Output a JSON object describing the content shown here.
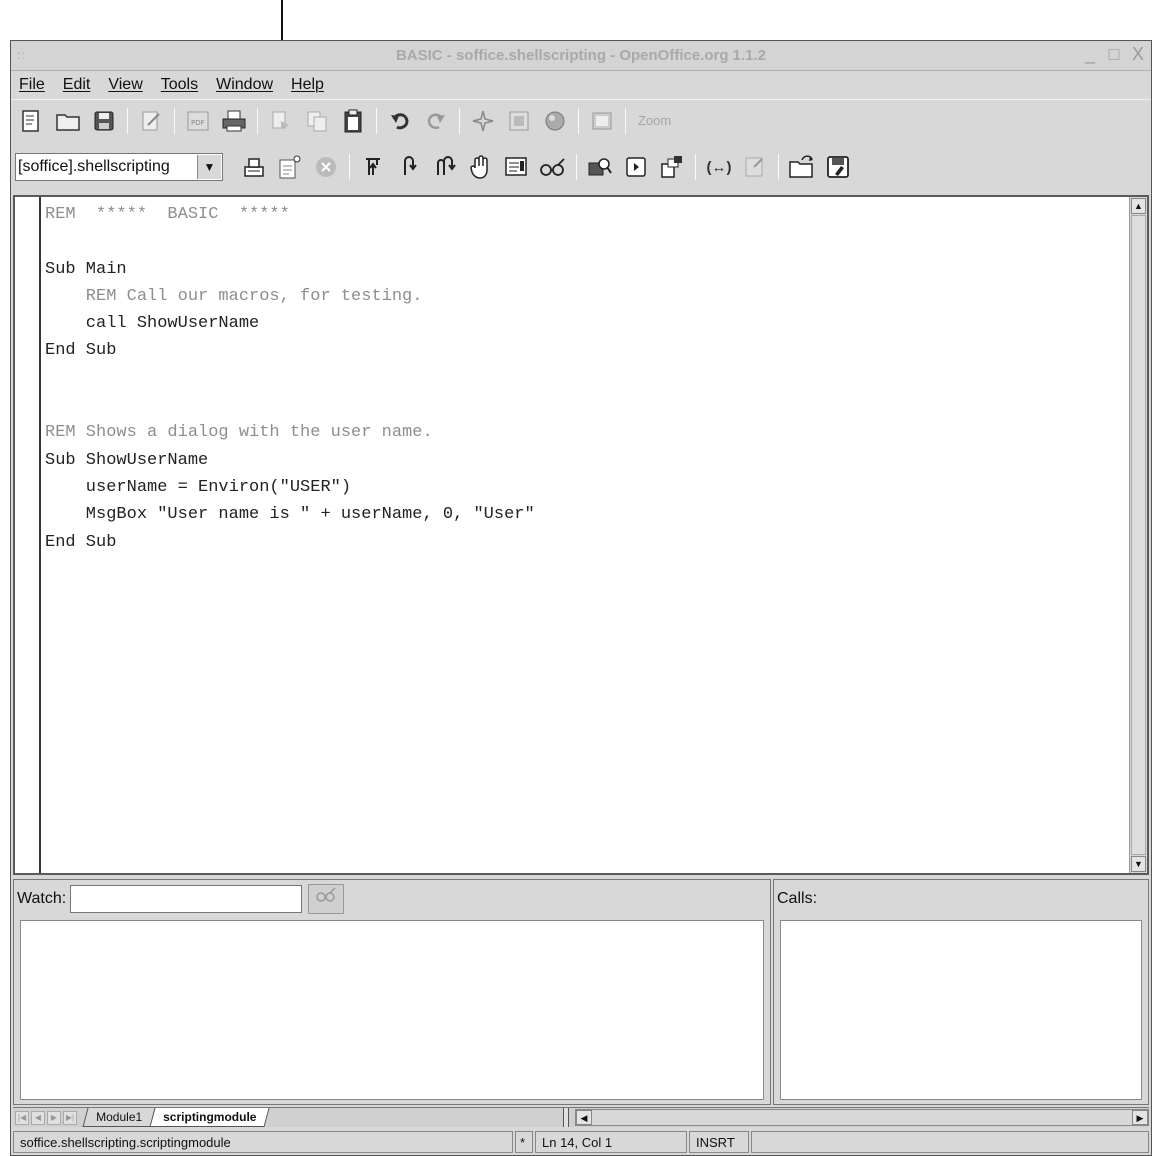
{
  "window": {
    "title": "BASIC - soffice.shellscripting - OpenOffice.org 1.1.2",
    "grip": "::",
    "controls": [
      "_",
      "□",
      "X"
    ]
  },
  "menu": [
    "File",
    "Edit",
    "View",
    "Tools",
    "Window",
    "Help"
  ],
  "toolbar": {
    "zoom_label": "Zoom"
  },
  "macro_toolbar": {
    "library_select": "[soffice].shellscripting"
  },
  "editor": {
    "lines": [
      {
        "text": "REM  *****  BASIC  *****",
        "kind": "rem"
      },
      {
        "text": "",
        "kind": "code"
      },
      {
        "text": "Sub Main",
        "kind": "code"
      },
      {
        "text": "    REM Call our macros, for testing.",
        "kind": "rem"
      },
      {
        "text": "    call ShowUserName",
        "kind": "code"
      },
      {
        "text": "End Sub",
        "kind": "code"
      },
      {
        "text": "",
        "kind": "code"
      },
      {
        "text": "",
        "kind": "code"
      },
      {
        "text": "REM Shows a dialog with the user name.",
        "kind": "rem"
      },
      {
        "text": "Sub ShowUserName",
        "kind": "code"
      },
      {
        "text": "    userName = Environ(\"USER\")",
        "kind": "code"
      },
      {
        "text": "    MsgBox \"User name is \" + userName, 0, \"User\"",
        "kind": "code"
      },
      {
        "text": "End Sub",
        "kind": "code"
      }
    ]
  },
  "watch": {
    "label": "Watch:",
    "value": ""
  },
  "calls": {
    "label": "Calls:"
  },
  "tabs": [
    {
      "label": "Module1",
      "active": false
    },
    {
      "label": "scriptingmodule",
      "active": true
    }
  ],
  "status": {
    "location": "soffice.shellscripting.scriptingmodule",
    "modified": "*",
    "position": "Ln 14, Col 1",
    "mode": "INSRT",
    "extra": ""
  }
}
